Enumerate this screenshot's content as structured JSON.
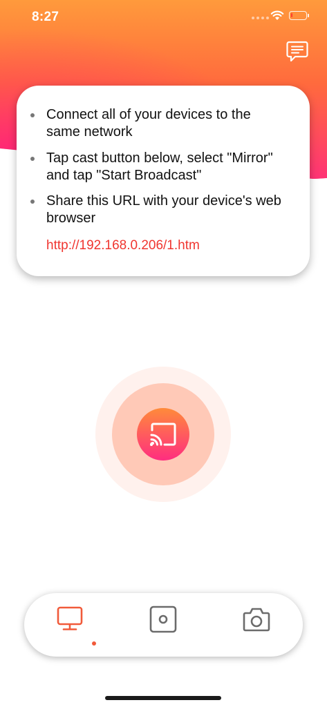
{
  "status_bar": {
    "time": "8:27",
    "battery_level": 0.1,
    "battery_color": "#ff3b30"
  },
  "header": {
    "gradient_colors": [
      "#ff9a3c",
      "#ff6a3d",
      "#ff2f7a"
    ],
    "feedback_icon": "chat-bubble-lines-icon"
  },
  "instructions": {
    "items": [
      {
        "text": "Connect all of your devices to the same network"
      },
      {
        "text": "Tap cast button below, select \"Mirror\" and tap \"Start Broadcast\""
      },
      {
        "text": "Share this URL with your device's web browser"
      }
    ],
    "url": "http://192.168.0.206/1.htm",
    "url_color": "#f0352f"
  },
  "cast_button": {
    "icon": "cast-icon",
    "gradient_colors": [
      "#ff8b3a",
      "#ff2d80"
    ]
  },
  "tab_bar": {
    "tabs": [
      {
        "name": "screen-mirror",
        "icon": "monitor-icon",
        "selected": true
      },
      {
        "name": "record",
        "icon": "record-square-icon",
        "selected": false
      },
      {
        "name": "camera",
        "icon": "camera-icon",
        "selected": false
      }
    ],
    "active_color": "#f15a3a",
    "inactive_color": "#6b6b6b"
  }
}
